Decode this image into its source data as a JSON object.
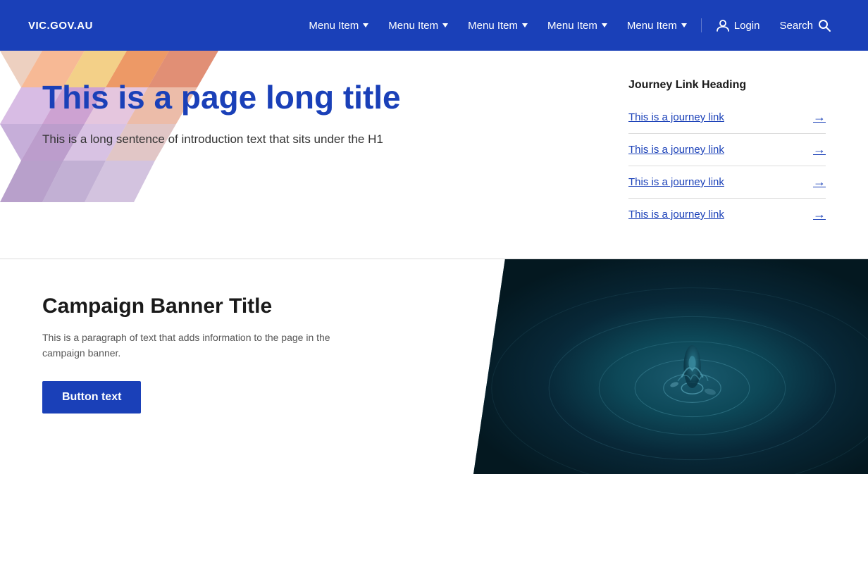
{
  "nav": {
    "logo": "VIC.GOV.AU",
    "menu_items": [
      {
        "label": "Menu Item"
      },
      {
        "label": "Menu Item"
      },
      {
        "label": "Menu Item"
      },
      {
        "label": "Menu Item"
      },
      {
        "label": "Menu Item"
      }
    ],
    "login_label": "Login",
    "search_label": "Search"
  },
  "hero": {
    "title": "This is a page long title",
    "intro": "This is a long sentence of introduction text that sits under the H1",
    "journey": {
      "heading": "Journey Link Heading",
      "links": [
        "This is a journey link",
        "This is a journey link",
        "This is a journey link",
        "This is a journey link"
      ]
    }
  },
  "campaign": {
    "title": "Campaign Banner Title",
    "text": "This is a paragraph of text that adds information to the page in the campaign banner.",
    "button_label": "Button text"
  }
}
